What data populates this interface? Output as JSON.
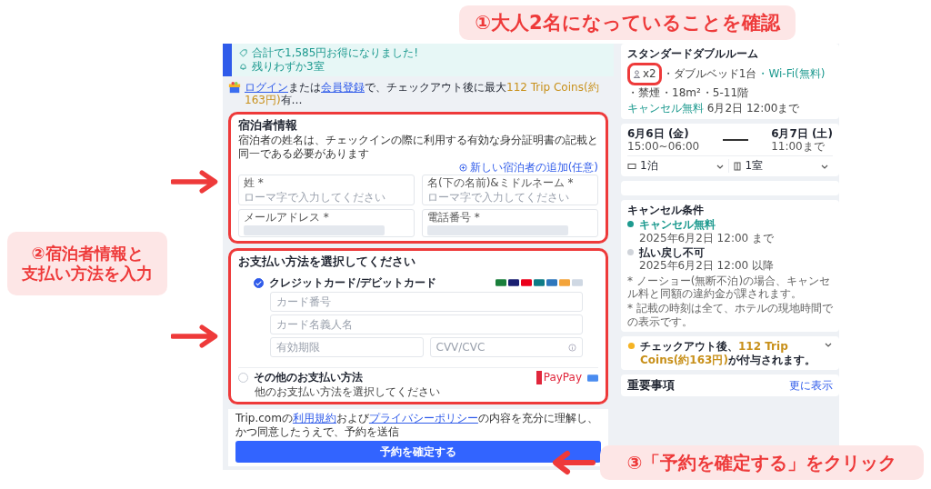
{
  "banner": {
    "lines": [
      "合計で1,585円お得になりました!",
      "残りわずか3室"
    ]
  },
  "login_prompt": {
    "login_link": "ログイン",
    "or": "または",
    "register_link": "会員登録",
    "text": "で、チェックアウト後に最大",
    "coins": "112 Trip Coins(約163円)",
    "rest": "有…"
  },
  "guest_info": {
    "title": "宿泊者情報",
    "highlighted": true,
    "note": "宿泊者の姓名は、チェックインの際に利用する有効な身分証明書の記載と同一である必要があります",
    "add_guest": "新しい宿泊者の追加(任意)",
    "fields": [
      {
        "label": "姓 *",
        "placeholder": "ローマ字で入力してください",
        "masked": false
      },
      {
        "label": "名(下の名前)&ミドルネーム *",
        "placeholder": "ローマ字で入力してください",
        "masked": false
      },
      {
        "label": "メールアドレス *",
        "masked": true
      },
      {
        "label": "電話番号 *",
        "masked": true
      }
    ]
  },
  "payment": {
    "title": "お支払い方法を選択してください",
    "highlighted": true,
    "methods": [
      {
        "kind": "card",
        "label": "クレジットカード/デビットカード",
        "selected": true,
        "rows": [
          [
            {
              "placeholder": "カード番号",
              "info": false
            }
          ],
          [
            {
              "placeholder": "カード名義人名",
              "info": false
            }
          ],
          [
            {
              "placeholder": "有効期限",
              "info": false
            },
            {
              "placeholder": "CVV/CVC",
              "info": true
            }
          ]
        ]
      },
      {
        "kind": "other",
        "label": "その他のお支払い方法",
        "selected": false,
        "note": "他のお支払い方法を選択してください",
        "badge": "PayPay"
      }
    ]
  },
  "terms": {
    "prefix": "Trip.comの",
    "terms_link": "利用規約",
    "and": "および",
    "privacy_link": "プライバシーポリシー",
    "rest": "の内容を充分に理解し、かつ同意したうえで、予約を送信"
  },
  "submit": "予約を確定する",
  "room": {
    "name": "スタンダードダブルルーム",
    "guests": "x2",
    "guests_highlighted": true,
    "details": [
      {
        "text": "・ダブルベッド1台",
        "free": false
      },
      {
        "text": "・Wi-Fi(無料)",
        "free": true
      },
      {
        "text": "・禁煙",
        "free": false
      },
      {
        "text": "・18m²",
        "free": false
      },
      {
        "text": "・5-11階",
        "free": false
      }
    ],
    "cancel_text": "キャンセル無料",
    "cancel_deadline": "6月2日 12:00まで"
  },
  "stay": {
    "checkin_date": "6月6日 (金)",
    "checkin_time": "15:00~06:00",
    "checkout_date": "6月7日 (土)",
    "checkout_time": "11:00まで",
    "nights": "1泊",
    "rooms": "1室"
  },
  "cancellation": {
    "title": "キャンセル条件",
    "steps": [
      {
        "label": "キャンセル無料",
        "time": "2025年6月2日 12:00 まで",
        "free": true
      },
      {
        "label": "払い戻し不可",
        "time": "2025年6月2日 12:00 以降",
        "free": false
      }
    ],
    "notes": [
      "* ノーショー(無断不泊)の場合、キャンセル料と同額の違約金が課されます。",
      "* 記載の時刻は全て、ホテルの現地時間での表示です。"
    ]
  },
  "coins": {
    "prefix": "チェックアウト後、",
    "amount": "112 Trip Coins(約163円)",
    "suffix": "が付与されます。"
  },
  "notices": {
    "title": "重要事項",
    "more": "更に表示"
  },
  "annotations": {
    "step1": "①大人2名になっていることを確認",
    "step2": [
      "②宿泊者情報と",
      "支払い方法を入力"
    ],
    "step3": "③「予約を確定する」をクリック"
  }
}
